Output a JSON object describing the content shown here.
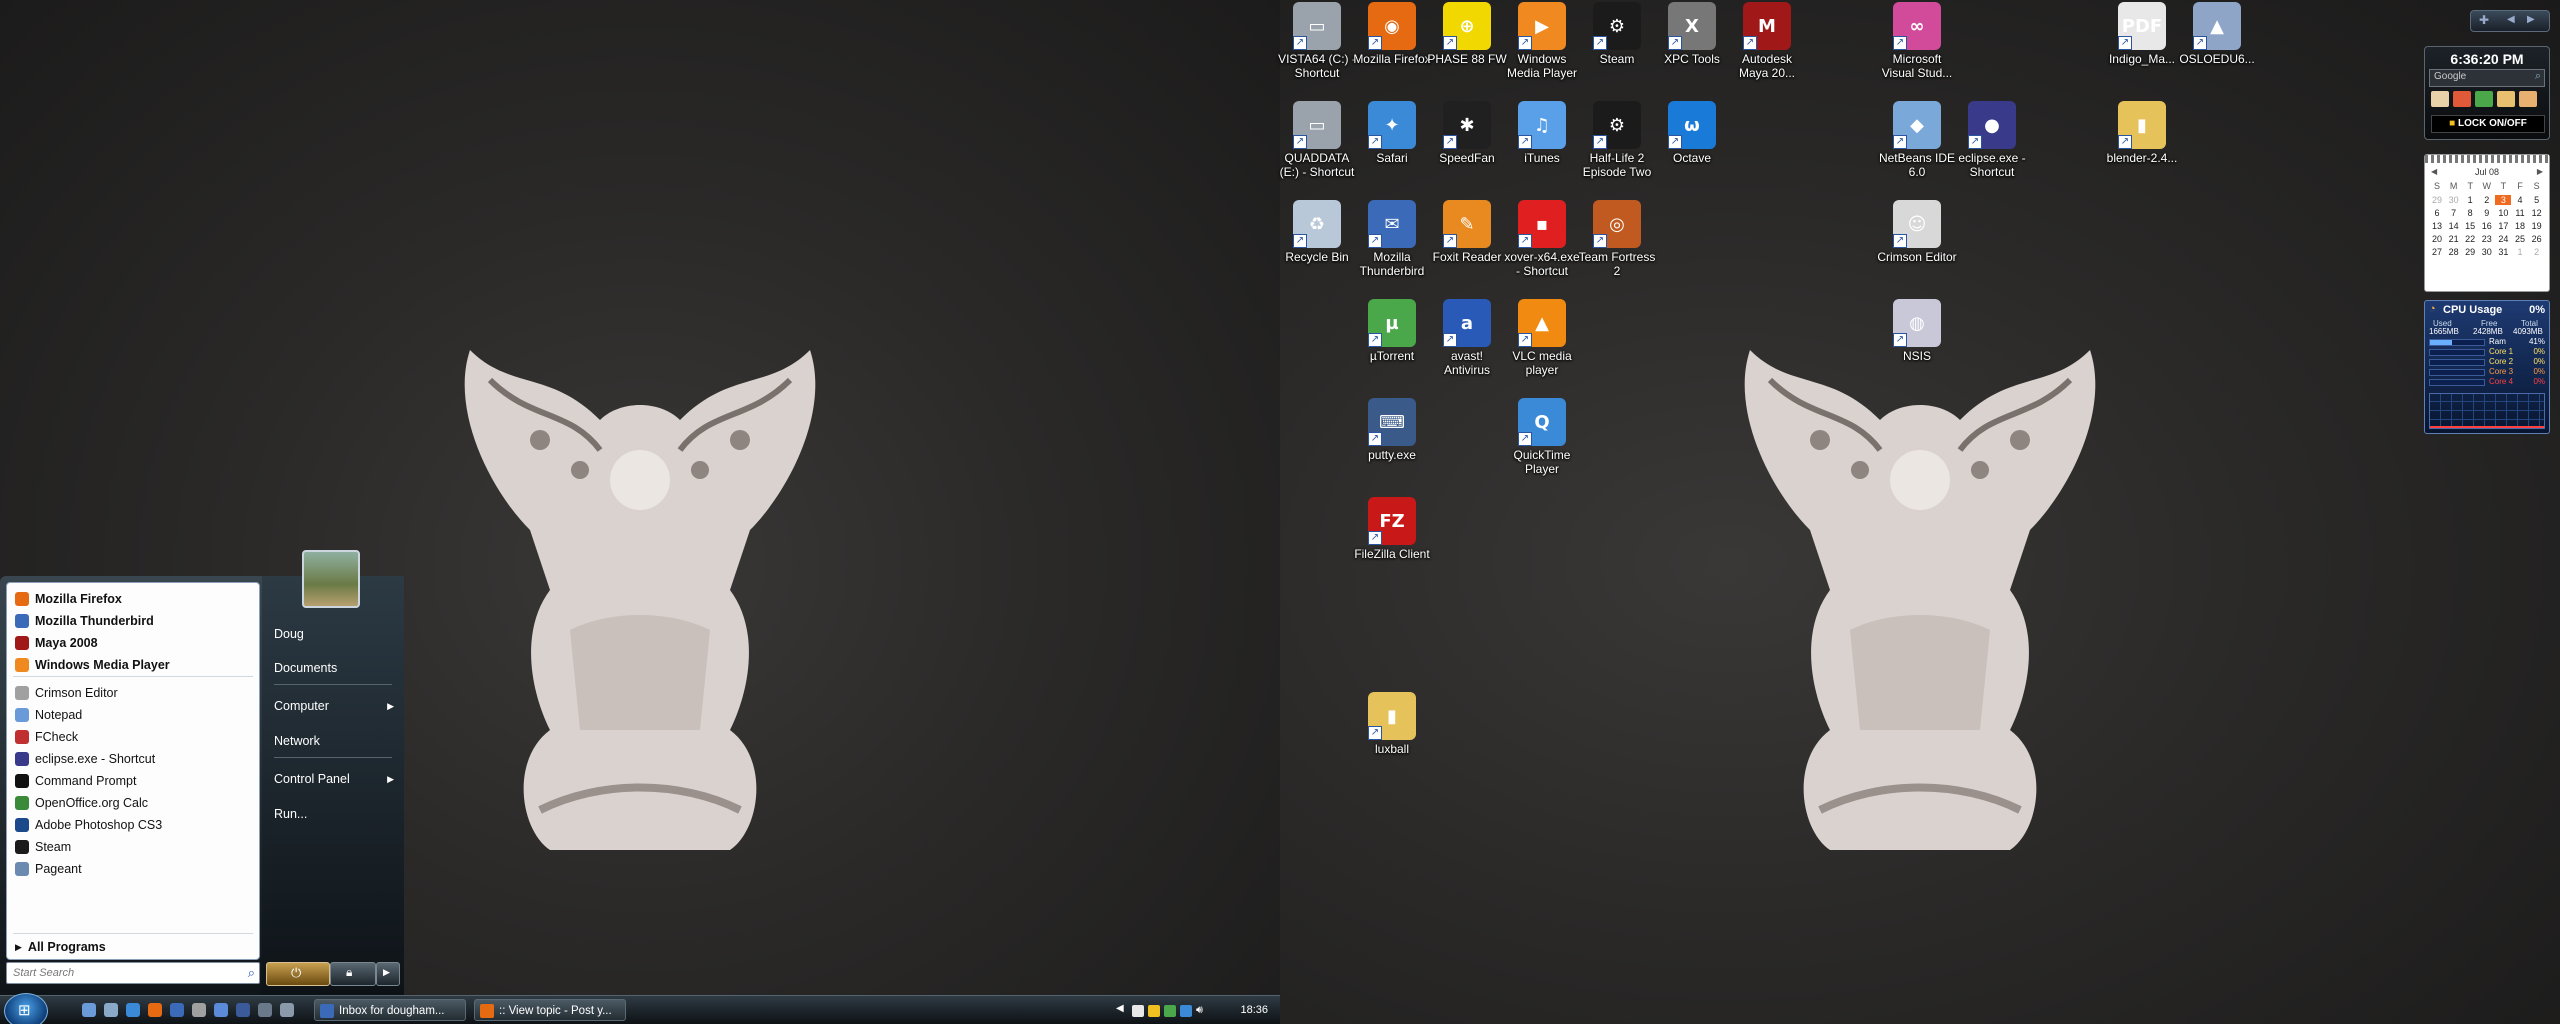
{
  "desktop": {
    "icons": [
      {
        "id": "vista64",
        "label": "VISTA64 (C:) - Shortcut",
        "color": "#9aa3ab",
        "glyph": "▭"
      },
      {
        "id": "firefox",
        "label": "Mozilla Firefox",
        "color": "#e66a12",
        "glyph": "◉"
      },
      {
        "id": "phase88",
        "label": "PHASE 88 FW",
        "color": "#f0d800",
        "glyph": "⊕"
      },
      {
        "id": "wmp",
        "label": "Windows Media Player",
        "color": "#f08a20",
        "glyph": "▶"
      },
      {
        "id": "steam",
        "label": "Steam",
        "color": "#1b1b1b",
        "glyph": "⚙"
      },
      {
        "id": "xpc",
        "label": "XPC Tools",
        "color": "#777777",
        "glyph": "X"
      },
      {
        "id": "maya",
        "label": "Autodesk Maya 20...",
        "color": "#a01818",
        "glyph": "M"
      },
      {
        "id": "msvs",
        "label": "Microsoft Visual Stud...",
        "color": "#d24a9a",
        "glyph": "∞"
      },
      {
        "id": "indigo",
        "label": "Indigo_Ma...",
        "color": "#e8e8e8",
        "glyph": "PDF"
      },
      {
        "id": "osloedu",
        "label": "OSLOEDU6...",
        "color": "#8fa5c8",
        "glyph": "▲"
      },
      {
        "id": "quaddata",
        "label": "QUADDATA (E:) - Shortcut",
        "color": "#9aa3ab",
        "glyph": "▭"
      },
      {
        "id": "safari",
        "label": "Safari",
        "color": "#3a8ad8",
        "glyph": "✦"
      },
      {
        "id": "speedfan",
        "label": "SpeedFan",
        "color": "#202020",
        "glyph": "✱"
      },
      {
        "id": "itunes",
        "label": "iTunes",
        "color": "#5aa0e8",
        "glyph": "♫"
      },
      {
        "id": "hl2",
        "label": "Half-Life 2 Episode Two",
        "color": "#1b1b1b",
        "glyph": "⚙"
      },
      {
        "id": "octave",
        "label": "Octave",
        "color": "#1a7ad8",
        "glyph": "ω"
      },
      {
        "id": "netbeans",
        "label": "NetBeans IDE 6.0",
        "color": "#7aa8d8",
        "glyph": "◆"
      },
      {
        "id": "eclipse",
        "label": "eclipse.exe - Shortcut",
        "color": "#3a3a8a",
        "glyph": "●"
      },
      {
        "id": "blender",
        "label": "blender-2.4...",
        "color": "#e6c35a",
        "glyph": "▮"
      },
      {
        "id": "recycle",
        "label": "Recycle Bin",
        "color": "#b8c8d8",
        "glyph": "♻"
      },
      {
        "id": "thunderbird",
        "label": "Mozilla Thunderbird",
        "color": "#3a6ab8",
        "glyph": "✉"
      },
      {
        "id": "foxit",
        "label": "Foxit Reader",
        "color": "#e88a20",
        "glyph": "✎"
      },
      {
        "id": "xover",
        "label": "xover-x64.exe - Shortcut",
        "color": "#e02020",
        "glyph": "▪"
      },
      {
        "id": "tf2",
        "label": "Team Fortress 2",
        "color": "#c05a20",
        "glyph": "◎"
      },
      {
        "id": "crimson",
        "label": "Crimson Editor",
        "color": "#d8d8d8",
        "glyph": "☺"
      },
      {
        "id": "utorrent",
        "label": "µTorrent",
        "color": "#4aa84a",
        "glyph": "µ"
      },
      {
        "id": "avast",
        "label": "avast! Antivirus",
        "color": "#2a5ab8",
        "glyph": "a"
      },
      {
        "id": "vlc",
        "label": "VLC media player",
        "color": "#f08a10",
        "glyph": "▲"
      },
      {
        "id": "nsis",
        "label": "NSIS",
        "color": "#c8c8d8",
        "glyph": "◍"
      },
      {
        "id": "putty",
        "label": "putty.exe",
        "color": "#3a5a8a",
        "glyph": "⌨"
      },
      {
        "id": "quicktime",
        "label": "QuickTime Player",
        "color": "#3a8ad8",
        "glyph": "Q"
      },
      {
        "id": "filezilla",
        "label": "FileZilla Client",
        "color": "#c81818",
        "glyph": "FZ"
      },
      {
        "id": "luxball",
        "label": "luxball",
        "color": "#e6c35a",
        "glyph": "▮"
      }
    ]
  },
  "start_menu": {
    "pinned": [
      {
        "label": "Mozilla Firefox",
        "color": "#e66a12"
      },
      {
        "label": "Mozilla Thunderbird",
        "color": "#3a6ab8"
      },
      {
        "label": "Maya 2008",
        "color": "#a01818"
      },
      {
        "label": "Windows Media Player",
        "color": "#f08a20"
      }
    ],
    "recent": [
      {
        "label": "Crimson Editor",
        "color": "#a0a0a0"
      },
      {
        "label": "Notepad",
        "color": "#6a9ad8"
      },
      {
        "label": "FCheck",
        "color": "#c03030"
      },
      {
        "label": "eclipse.exe - Shortcut",
        "color": "#3a3a8a"
      },
      {
        "label": "Command Prompt",
        "color": "#111111"
      },
      {
        "label": "OpenOffice.org Calc",
        "color": "#3a8a3a"
      },
      {
        "label": "Adobe Photoshop CS3",
        "color": "#1a4a8a"
      },
      {
        "label": "Steam",
        "color": "#1b1b1b"
      },
      {
        "label": "Pageant",
        "color": "#6a8ab0"
      }
    ],
    "all_programs": "All Programs",
    "search_placeholder": "Start Search",
    "right": {
      "user": "Doug",
      "documents": "Documents",
      "computer": "Computer",
      "network": "Network",
      "control_panel": "Control Panel",
      "run": "Run..."
    }
  },
  "taskbar": {
    "buttons": [
      {
        "label": "Inbox for dougham...",
        "color": "#3a6ab8"
      },
      {
        "label": ":: View topic - Post y...",
        "color": "#e66a12"
      }
    ],
    "clock": "18:36"
  },
  "gadgets": {
    "clock": {
      "time": "6:36:20 PM",
      "search_placeholder": "Google",
      "lock": "LOCK ON/OFF"
    },
    "calendar": {
      "month": "Jul 08",
      "weekdays": [
        "S",
        "M",
        "T",
        "W",
        "T",
        "F",
        "S"
      ],
      "days": [
        [
          "29",
          "30",
          "1",
          "2",
          "3",
          "4",
          "5"
        ],
        [
          "6",
          "7",
          "8",
          "9",
          "10",
          "11",
          "12"
        ],
        [
          "13",
          "14",
          "15",
          "16",
          "17",
          "18",
          "19"
        ],
        [
          "20",
          "21",
          "22",
          "23",
          "24",
          "25",
          "26"
        ],
        [
          "27",
          "28",
          "29",
          "30",
          "31",
          "1",
          "2"
        ]
      ],
      "today": "3"
    },
    "cpu": {
      "title": "CPU Usage",
      "percent": "0%",
      "cols": [
        "Used",
        "Free",
        "Total"
      ],
      "mem": [
        "1665MB",
        "2428MB",
        "4093MB"
      ],
      "rows": [
        {
          "label": "Ram",
          "value": "41%",
          "color": "#ffffff",
          "fill": 0.41
        },
        {
          "label": "Core 1",
          "value": "0%",
          "color": "#ffe060",
          "fill": 0.0
        },
        {
          "label": "Core 2",
          "value": "0%",
          "color": "#ffe060",
          "fill": 0.0
        },
        {
          "label": "Core 3",
          "value": "0%",
          "color": "#ff9a40",
          "fill": 0.0
        },
        {
          "label": "Core 4",
          "value": "0%",
          "color": "#ff4040",
          "fill": 0.0
        }
      ]
    }
  }
}
